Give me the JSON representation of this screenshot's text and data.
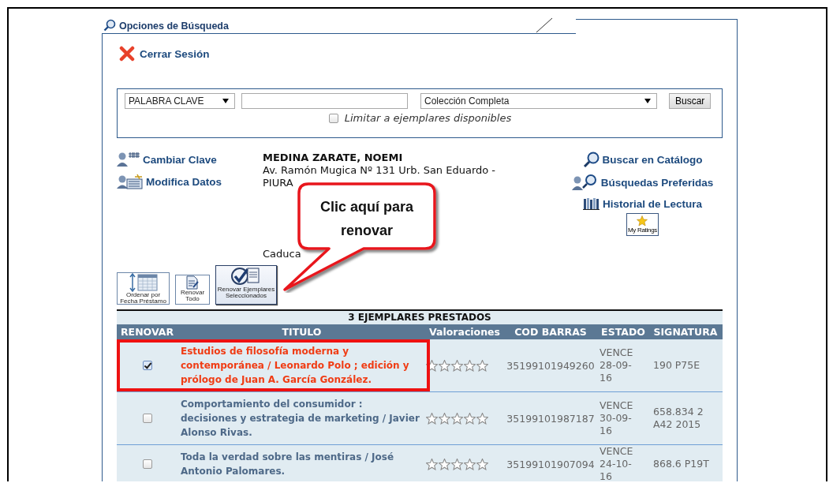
{
  "panel": {
    "title": "Opciones de Búsqueda",
    "logout": "Cerrar Sesión"
  },
  "search": {
    "field_type": "PALABRA CLAVE",
    "collection": "Colección Completa",
    "button": "Buscar",
    "limit_label": "Limitar a ejemplares disponibles",
    "limit_checked": false
  },
  "left_links": [
    {
      "kind": "key",
      "label": "Cambiar Clave"
    },
    {
      "kind": "edit",
      "label": "Modifica Datos"
    }
  ],
  "user": {
    "name": "MEDINA ZARATE, NOEMI",
    "address": "Av. Ramón Mugica Nº 131 Urb. San Eduardo - PIURA",
    "expiry": "Caduca"
  },
  "right_links": [
    {
      "kind": "search",
      "label": "Buscar en Catálogo"
    },
    {
      "kind": "saved",
      "label": "Búsquedas Preferidas"
    },
    {
      "kind": "history",
      "label": "Historial de Lectura"
    }
  ],
  "ratings_button": "My Ratings",
  "toolbar": [
    {
      "kind": "sort",
      "label": "Ordenar por Fecha Préstamo"
    },
    {
      "kind": "renew_all",
      "label": "Renovar Todo"
    },
    {
      "kind": "renew_selected",
      "label": "Renovar Ejemplares Seleccionados"
    }
  ],
  "callout": "Clic aquí para renovar",
  "table": {
    "caption": "3 EJEMPLARES PRESTADOS",
    "columns": [
      "RENOVAR",
      "TITULO",
      "Valoraciones",
      "COD BARRAS",
      "ESTADO",
      "SIGNATURA"
    ],
    "rows": [
      {
        "checked": true,
        "highlighted": true,
        "title": "Estudios de filosofía moderna y contemporánea / Leonardo Polo ; edición y prólogo de Juan A. García González.",
        "stars": 0,
        "barcode": "35199101949260",
        "status": "VENCE 28-09-16",
        "call_number": "190 P75E"
      },
      {
        "checked": false,
        "highlighted": false,
        "title": "Comportamiento del consumidor : decisiones y estrategia de marketing / Javier Alonso Rivas.",
        "stars": 0,
        "barcode": "35199101987187",
        "status": "VENCE 30-09-16",
        "call_number": "658.834 2 A42 2015"
      },
      {
        "checked": false,
        "highlighted": false,
        "title": "Toda la verdad sobre las mentiras / José Antonio Palomares.",
        "stars": 0,
        "barcode": "35199101907094",
        "status": "VENCE 24-10-16",
        "call_number": "868.6 P19T"
      }
    ]
  }
}
